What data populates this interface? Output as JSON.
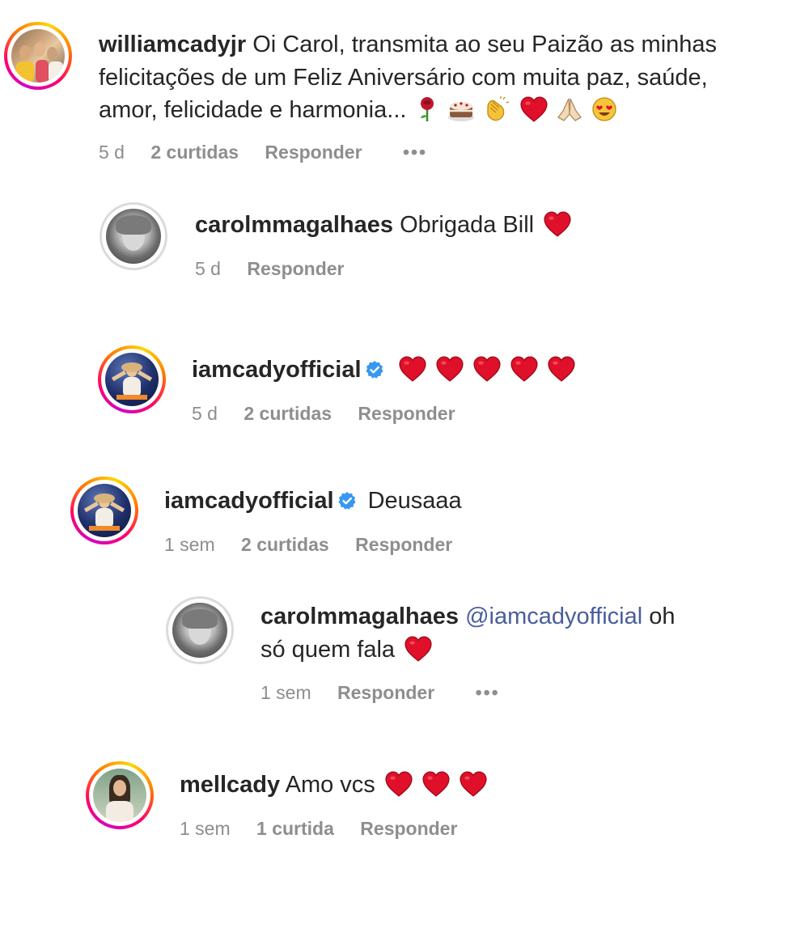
{
  "comments": [
    {
      "username": "williamcadyjr",
      "text_line1": "Oi Carol, transmita ao seu Paizão as minhas",
      "text_line2": "felicitações de um Feliz Aniversário com muita paz, saúde,",
      "text_line3": "amor, felicidade e harmonia...",
      "time": "5 d",
      "likes": "2 curtidas",
      "reply": "Responder",
      "more": "•••",
      "emojis": [
        "rose-icon",
        "cake-icon",
        "clapping-hands-icon",
        "red-heart-icon",
        "folded-hands-icon",
        "heart-eyes-icon"
      ]
    },
    {
      "username": "carolmmagalhaes",
      "text": "Obrigada Bill",
      "time": "5 d",
      "reply": "Responder",
      "emojis": [
        "red-heart-icon"
      ]
    },
    {
      "username": "iamcadyofficial",
      "verified": true,
      "text": "",
      "time": "5 d",
      "likes": "2 curtidas",
      "reply": "Responder",
      "emojis": [
        "red-heart-icon",
        "red-heart-icon",
        "red-heart-icon",
        "red-heart-icon",
        "red-heart-icon"
      ]
    },
    {
      "username": "iamcadyofficial",
      "verified": true,
      "text": "Deusaaa",
      "time": "1 sem",
      "likes": "2 curtidas",
      "reply": "Responder"
    },
    {
      "username": "carolmmagalhaes",
      "mention": "@iamcadyofficial",
      "text_line1": "oh",
      "text_line2": "só quem fala",
      "time": "1 sem",
      "reply": "Responder",
      "more": "•••",
      "emojis": [
        "red-heart-icon"
      ]
    },
    {
      "username": "mellcady",
      "text": "Amo vcs",
      "time": "1 sem",
      "likes": "1 curtida",
      "reply": "Responder",
      "emojis": [
        "red-heart-icon",
        "red-heart-icon",
        "red-heart-icon"
      ]
    }
  ],
  "colors": {
    "text": "#262626",
    "secondary": "#8e8e8e",
    "mention": "#4a5d9e",
    "heart": "#e0102a",
    "verified": "#3897f0"
  }
}
